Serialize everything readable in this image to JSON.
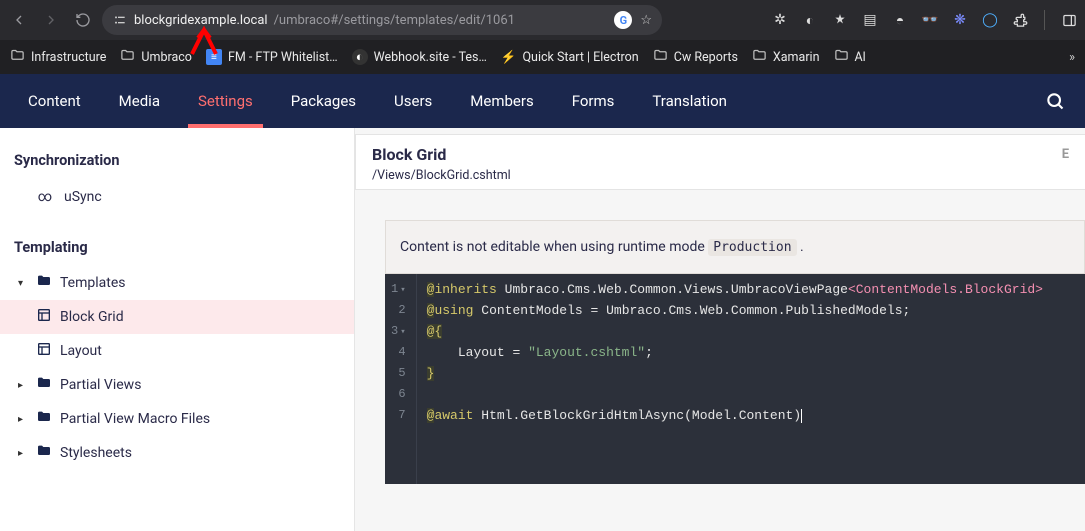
{
  "browser": {
    "url_domain": "blockgridexample.local",
    "url_path": "/umbraco#/settings/templates/edit/1061"
  },
  "bookmarks": [
    {
      "label": "Infrastructure",
      "icon": "folder"
    },
    {
      "label": "Umbraco",
      "icon": "folder"
    },
    {
      "label": "FM - FTP Whitelist…",
      "icon": "gdoc"
    },
    {
      "label": "Webhook.site - Tes…",
      "icon": "globe"
    },
    {
      "label": "Quick Start | Electron",
      "icon": "bolt"
    },
    {
      "label": "Cw Reports",
      "icon": "folder"
    },
    {
      "label": "Xamarin",
      "icon": "folder"
    },
    {
      "label": "Al",
      "icon": "folder"
    }
  ],
  "umbraco_nav": [
    "Content",
    "Media",
    "Settings",
    "Packages",
    "Users",
    "Members",
    "Forms",
    "Translation"
  ],
  "umbraco_nav_active": "Settings",
  "sidebar": {
    "sections": [
      {
        "title": "Synchronization",
        "items": [
          {
            "label": "uSync",
            "icon": "infinity"
          }
        ]
      },
      {
        "title": "Templating",
        "items": []
      }
    ],
    "tree": [
      {
        "label": "Templates",
        "level": 0,
        "expanded": true
      },
      {
        "label": "Block Grid",
        "level": 1,
        "selected": true
      },
      {
        "label": "Layout",
        "level": 1
      },
      {
        "label": "Partial Views",
        "level": 0
      },
      {
        "label": "Partial View Macro Files",
        "level": 0
      },
      {
        "label": "Stylesheets",
        "level": 0
      }
    ]
  },
  "content": {
    "title": "Block Grid",
    "right_indicator": "E",
    "path": "/Views/BlockGrid.cshtml",
    "notice_pre": "Content is not editable when using runtime mode ",
    "notice_mode": "Production",
    "notice_post": " ."
  },
  "code": {
    "lines": [
      "@inherits Umbraco.Cms.Web.Common.Views.UmbracoViewPage<ContentModels.BlockGrid>",
      "@using ContentModels = Umbraco.Cms.Web.Common.PublishedModels;",
      "@{",
      "    Layout = \"Layout.cshtml\";",
      "}",
      "",
      "@await Html.GetBlockGridHtmlAsync(Model.Content)"
    ]
  }
}
